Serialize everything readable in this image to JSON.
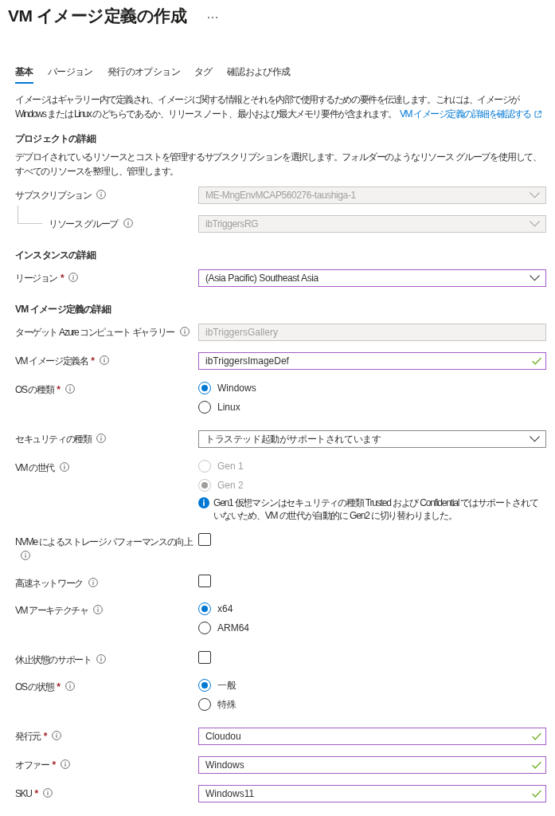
{
  "header": {
    "title": "VM イメージ定義の作成"
  },
  "tabs": [
    {
      "label": "基本",
      "selected": true
    },
    {
      "label": "バージョン",
      "selected": false
    },
    {
      "label": "発行のオプション",
      "selected": false
    },
    {
      "label": "タグ",
      "selected": false
    },
    {
      "label": "確認および作成",
      "selected": false
    }
  ],
  "intro": {
    "text": "イメージはギャラリー内で定義され、イメージに関する情報とそれを内部で使用するための要件を伝達します。これには、イメージが Windows または Linux のどちらであるか、リリース ノート、最小および最大メモリ要件が含まれます。",
    "link": "VM イメージ定義の詳細を確認する"
  },
  "sections": [
    {
      "title": "プロジェクトの詳細",
      "description": "デプロイされているリソースとコストを管理するサブスクリプションを選択します。フォルダーのようなリソース グループを使用して、すべてのリソースを整理し、管理します。",
      "fields": [
        {
          "kind": "dropdown",
          "label": "サブスクリプション",
          "info": true,
          "value": "ME-MngEnvMCAP560276-taushiga-1",
          "disabled": true,
          "changed": false,
          "children": [
            {
              "kind": "dropdown",
              "label": "リソース グループ",
              "info": true,
              "value": "ibTriggersRG",
              "disabled": true,
              "changed": false
            }
          ]
        }
      ]
    },
    {
      "title": "インスタンスの詳細",
      "fields": [
        {
          "kind": "dropdown",
          "label": "リージョン",
          "required_mark": "*",
          "info": true,
          "value": "(Asia Pacific) Southeast Asia",
          "disabled": false,
          "changed": true
        }
      ]
    },
    {
      "title": "VM イメージ定義の詳細",
      "fields": [
        {
          "kind": "textbox",
          "label": "ターゲット Azure コンピュート ギャラリー",
          "info": true,
          "value": "ibTriggersGallery",
          "disabled": true,
          "changed": false,
          "valid": false
        },
        {
          "kind": "textbox",
          "label": "VM イメージ定義名",
          "required_mark": "*",
          "info": true,
          "value": "ibTriggersImageDef",
          "disabled": false,
          "changed": true,
          "valid": true
        },
        {
          "kind": "radio",
          "label": "OS の種類",
          "required_mark": "*",
          "info": true,
          "options": [
            {
              "label": "Windows",
              "selected": true,
              "disabled": false
            },
            {
              "label": "Linux",
              "selected": false,
              "disabled": false
            }
          ]
        },
        {
          "kind": "dropdown",
          "label": "セキュリティの種類",
          "info": true,
          "value": "トラステッド起動がサポートされています",
          "disabled": false,
          "changed": false
        },
        {
          "kind": "radio",
          "label": "VM の世代",
          "info": true,
          "options": [
            {
              "label": "Gen 1",
              "selected": false,
              "disabled": true
            },
            {
              "label": "Gen 2",
              "selected": true,
              "disabled": true
            }
          ],
          "note": "Gen1 仮想マシンはセキュリティの種類 Trusted および Confidential ではサポートされていないため、VM の世代が自動的に Gen2 に切り替わりました。"
        },
        {
          "kind": "checkbox",
          "label": "NVMe によるストレージ パフォーマンスの向上",
          "info": true,
          "checked": false
        },
        {
          "kind": "checkbox",
          "label": "高速ネットワーク",
          "info": true,
          "checked": false
        },
        {
          "kind": "radio",
          "label": "VM アーキテクチャ",
          "info": true,
          "options": [
            {
              "label": "x64",
              "selected": true,
              "disabled": false
            },
            {
              "label": "ARM64",
              "selected": false,
              "disabled": false
            }
          ]
        },
        {
          "kind": "checkbox",
          "label": "休止状態のサポート",
          "info": true,
          "checked": false
        },
        {
          "kind": "radio",
          "label": "OS の状態",
          "required_mark": "*",
          "info": true,
          "options": [
            {
              "label": "一般",
              "selected": true,
              "disabled": false
            },
            {
              "label": "特殊",
              "selected": false,
              "disabled": false
            }
          ]
        },
        {
          "kind": "textbox",
          "label": "発行元",
          "required_mark": "*",
          "info": true,
          "value": "Cloudou",
          "disabled": false,
          "changed": true,
          "valid": true
        },
        {
          "kind": "textbox",
          "label": "オファー",
          "required_mark": "*",
          "info": true,
          "value": "Windows",
          "disabled": false,
          "changed": true,
          "valid": true
        },
        {
          "kind": "textbox",
          "label": "SKU",
          "required_mark": "*",
          "info": true,
          "value": "Windows11",
          "disabled": false,
          "changed": true,
          "valid": true
        }
      ]
    }
  ]
}
